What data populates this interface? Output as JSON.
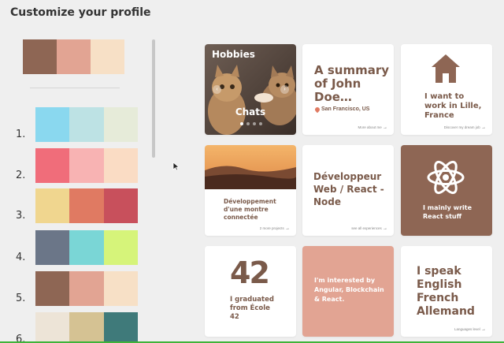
{
  "page": {
    "title": "Customize your profile"
  },
  "current_palette": [
    "#8e6654",
    "#e2a493",
    "#f7e0c6"
  ],
  "palettes": [
    {
      "number": "1.",
      "colors": [
        "#8ad8ef",
        "#bde2e4",
        "#e6ebd9"
      ]
    },
    {
      "number": "2.",
      "colors": [
        "#f06d7a",
        "#f8b3b3",
        "#fadcc4"
      ]
    },
    {
      "number": "3.",
      "colors": [
        "#f0d68f",
        "#e07a62",
        "#c8505c"
      ]
    },
    {
      "number": "4.",
      "colors": [
        "#6b7688",
        "#7ad6d6",
        "#d6f47a"
      ]
    },
    {
      "number": "5.",
      "colors": [
        "#8e6654",
        "#e2a493",
        "#f7e0c6"
      ]
    },
    {
      "number": "6.",
      "colors": [
        "#ede4d7",
        "#d5c293",
        "#3f7a7a"
      ]
    }
  ],
  "cards": {
    "hobbies": {
      "title": "Hobbies",
      "caption": "Chats"
    },
    "summary": {
      "title": "A summary of John Doe…",
      "location": "San Francisco, US",
      "link": "More about me"
    },
    "work": {
      "text": "I want to work in Lille, France",
      "link": "Discover my dream job"
    },
    "project": {
      "text": "Développement d'une montre connectée",
      "link": "2 more projects"
    },
    "job": {
      "text": "Développeur Web / React - Node",
      "link": "see all experiences"
    },
    "react": {
      "text": "I mainly write React stuff"
    },
    "education": {
      "logo": "42",
      "text": "I graduated from École 42"
    },
    "interests": {
      "text": "I'm interested by Angular, Blockchain & React."
    },
    "languages": {
      "text": "I speak English French Allemand",
      "link": "Languages level"
    }
  },
  "colors": {
    "accent": "#7a5a4a",
    "dark_card": "#8e6654",
    "pink_card": "#e2a493",
    "green_line": "#3fb33a"
  },
  "icons": {
    "home": "home-icon",
    "atom": "react-atom-icon",
    "pin": "location-pin-icon",
    "arrow": "arrow-right-icon"
  }
}
